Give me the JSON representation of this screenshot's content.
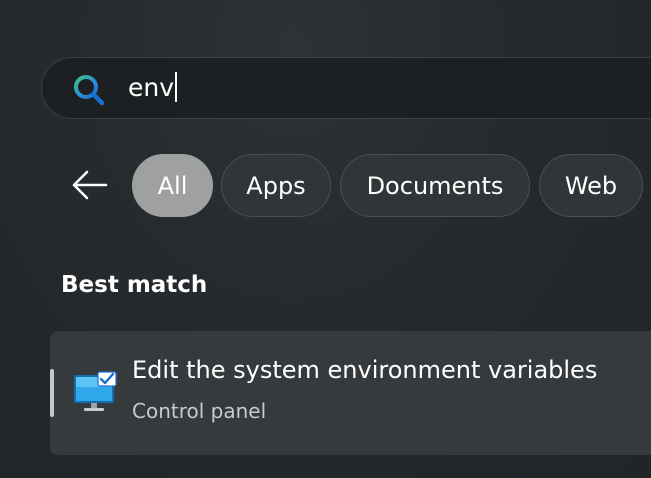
{
  "search": {
    "query": "env",
    "icon": "search-icon"
  },
  "filters": {
    "back_icon": "arrow-left-icon",
    "chips": [
      {
        "label": "All",
        "active": true
      },
      {
        "label": "Apps",
        "active": false
      },
      {
        "label": "Documents",
        "active": false
      },
      {
        "label": "Web",
        "active": false
      }
    ]
  },
  "results": {
    "section_heading": "Best match",
    "best_match": {
      "title": "Edit the system environment variables",
      "subtitle": "Control panel",
      "icon": "system-properties-icon"
    }
  },
  "colors": {
    "active_chip": "#9fa1a1",
    "search_accent_blue": "#2b8fe0",
    "search_accent_green": "#3fc47a"
  }
}
